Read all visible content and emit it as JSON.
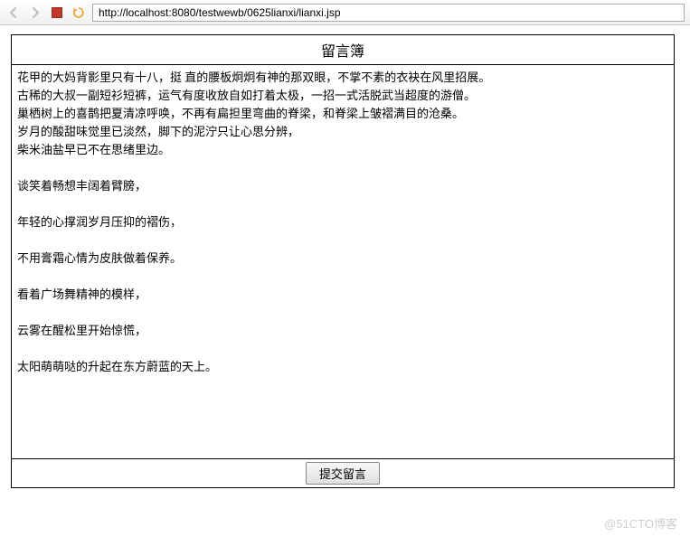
{
  "toolbar": {
    "url": "http://localhost:8080/testwewb/0625lianxi/lianxi.jsp"
  },
  "guestbook": {
    "title": "留言簿",
    "content": "花甲的大妈背影里只有十八，挺 直的腰板炯炯有神的那双眼，不掌不素的衣袂在风里招展。\n古稀的大叔一副短衫短裤，运气有度收放自如打着太极，一招一式活脱武当超度的游僧。\n巢栖树上的喜鹊把夏清凉呼唤，不再有扁担里弯曲的脊梁，和脊梁上皱褶满目的沧桑。\n岁月的酸甜味觉里已淡然，脚下的泥泞只让心思分辨，\n柴米油盐早已不在思绪里边。\n\n谈笑着畅想丰阔着臂膀，\n\n年轻的心撑润岁月压抑的褶伤，\n\n不用膏霜心情为皮肤做着保养。\n\n看着广场舞精神的模样，\n\n云雾在醒松里开始惊慌，\n\n太阳萌萌哒的升起在东方蔚蓝的天上。",
    "submit_label": "提交留言"
  },
  "watermark": "@51CTO博客"
}
